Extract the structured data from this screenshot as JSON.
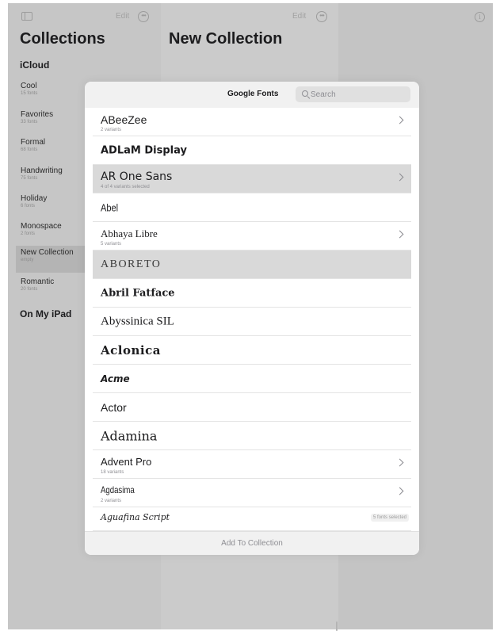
{
  "sidebar": {
    "edit_label": "Edit",
    "title": "Collections",
    "icloud_section": "iCloud",
    "ipad_section": "On My iPad",
    "items": [
      {
        "name": "Cool",
        "count": "15 fonts"
      },
      {
        "name": "Favorites",
        "count": "33 fonts"
      },
      {
        "name": "Formal",
        "count": "68 fonts"
      },
      {
        "name": "Handwriting",
        "count": "75 fonts"
      },
      {
        "name": "Holiday",
        "count": "6 fonts"
      },
      {
        "name": "Monospace",
        "count": "2 fonts"
      },
      {
        "name": "New Collection",
        "count": "empty",
        "selected": true
      },
      {
        "name": "Romantic",
        "count": "20 fonts"
      }
    ]
  },
  "middle": {
    "edit_label": "Edit",
    "title": "New Collection"
  },
  "sheet": {
    "title": "Google Fonts",
    "search_placeholder": "Search",
    "add_button": "Add To Collection",
    "fonts": [
      {
        "name": "ABeeZee",
        "sub": "2 variants",
        "chevron": true
      },
      {
        "name": "ADLaM Display"
      },
      {
        "name": "AR One Sans",
        "sub": "4 of 4 variants selected",
        "chevron": true,
        "selected": true
      },
      {
        "name": "Abel"
      },
      {
        "name": "Abhaya Libre",
        "sub": "5 variants",
        "chevron": true
      },
      {
        "name": "ABORETO",
        "selected": true
      },
      {
        "name": "Abril Fatface"
      },
      {
        "name": "Abyssinica SIL"
      },
      {
        "name": "Aclonica"
      },
      {
        "name": "Acme"
      },
      {
        "name": "Actor"
      },
      {
        "name": "Adamina"
      },
      {
        "name": "Advent Pro",
        "sub": "18 variants",
        "chevron": true
      },
      {
        "name": "Agdasima",
        "sub": "2 variants",
        "chevron": true
      },
      {
        "name": "Aguafina Script",
        "badge": "5 fonts selected"
      }
    ]
  },
  "colors": {
    "dim_background": "#c7c7c7",
    "selected_row": "#d9d9d9",
    "sheet_header": "#f1f1f1"
  }
}
